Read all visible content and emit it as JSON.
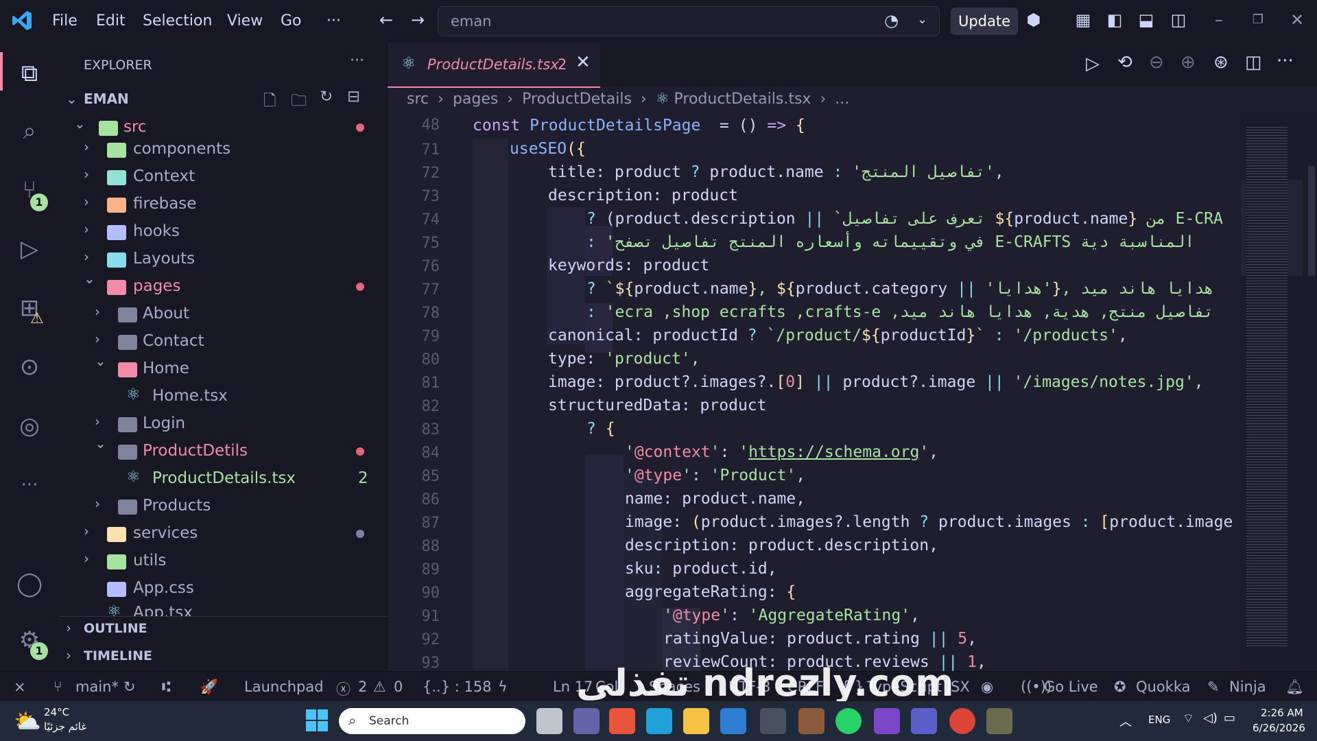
{
  "menu": [
    "File",
    "Edit",
    "Selection",
    "View",
    "Go",
    "···"
  ],
  "search_box": "eman",
  "update_label": "Update",
  "explorer": {
    "title": "EXPLORER",
    "workspace": "EMAN",
    "items": [
      {
        "label": "src",
        "git_dot": true
      },
      {
        "label": "components"
      },
      {
        "label": "Context"
      },
      {
        "label": "firebase"
      },
      {
        "label": "hooks"
      },
      {
        "label": "Layouts"
      },
      {
        "label": "pages",
        "git_dot": true
      },
      {
        "label": "About"
      },
      {
        "label": "Contact"
      },
      {
        "label": "Home"
      },
      {
        "label": "Home.tsx"
      },
      {
        "label": "Login"
      },
      {
        "label": "ProductDetils",
        "git_dot": true
      },
      {
        "label": "ProductDetails.tsx",
        "badge": "2"
      },
      {
        "label": "Products"
      },
      {
        "label": "services"
      },
      {
        "label": "utils"
      },
      {
        "label": "App.css"
      },
      {
        "label": "App.tsx"
      }
    ],
    "outline": "OUTLINE",
    "timeline": "TIMELINE"
  },
  "activity": {
    "scm_badge": "1",
    "settings_badge": "1"
  },
  "tab": {
    "filename": "ProductDetails.tsx",
    "problems": "2"
  },
  "breadcrumb": [
    "src",
    "pages",
    "ProductDetails",
    "ProductDetails.tsx",
    "..."
  ],
  "code": {
    "line_numbers": [
      "48",
      "71",
      "72",
      "73",
      "74",
      "75",
      "76",
      "77",
      "78",
      "79",
      "80",
      "81",
      "82",
      "83",
      "84",
      "85",
      "86",
      "87",
      "88",
      "89",
      "90",
      "91",
      "92",
      "93"
    ]
  },
  "status": {
    "branch": "main*",
    "launchpad": "Launchpad",
    "errors": "2",
    "warnings": "0",
    "braces": "{..} : 158",
    "ln": "Ln 17",
    "col": "Col",
    "spaces": "Spaces",
    "encoding": "UTF-8",
    "eol": "CRLF",
    "language": "TypeScript JSX",
    "golive": "Go Live",
    "quokka": "Quokka",
    "ninja": "Ninja"
  },
  "taskbar": {
    "temp": "24°C",
    "weather": "غائم جزئيًا",
    "search": "Search",
    "lang": "ENG",
    "time": "2:26 AM",
    "date": "6/26/2026"
  },
  "watermark": "تفذلي ndrezly.com",
  "colors": {
    "accent": "#f38ba8",
    "bg": "#1e1e2e",
    "sidebar": "#181825"
  }
}
